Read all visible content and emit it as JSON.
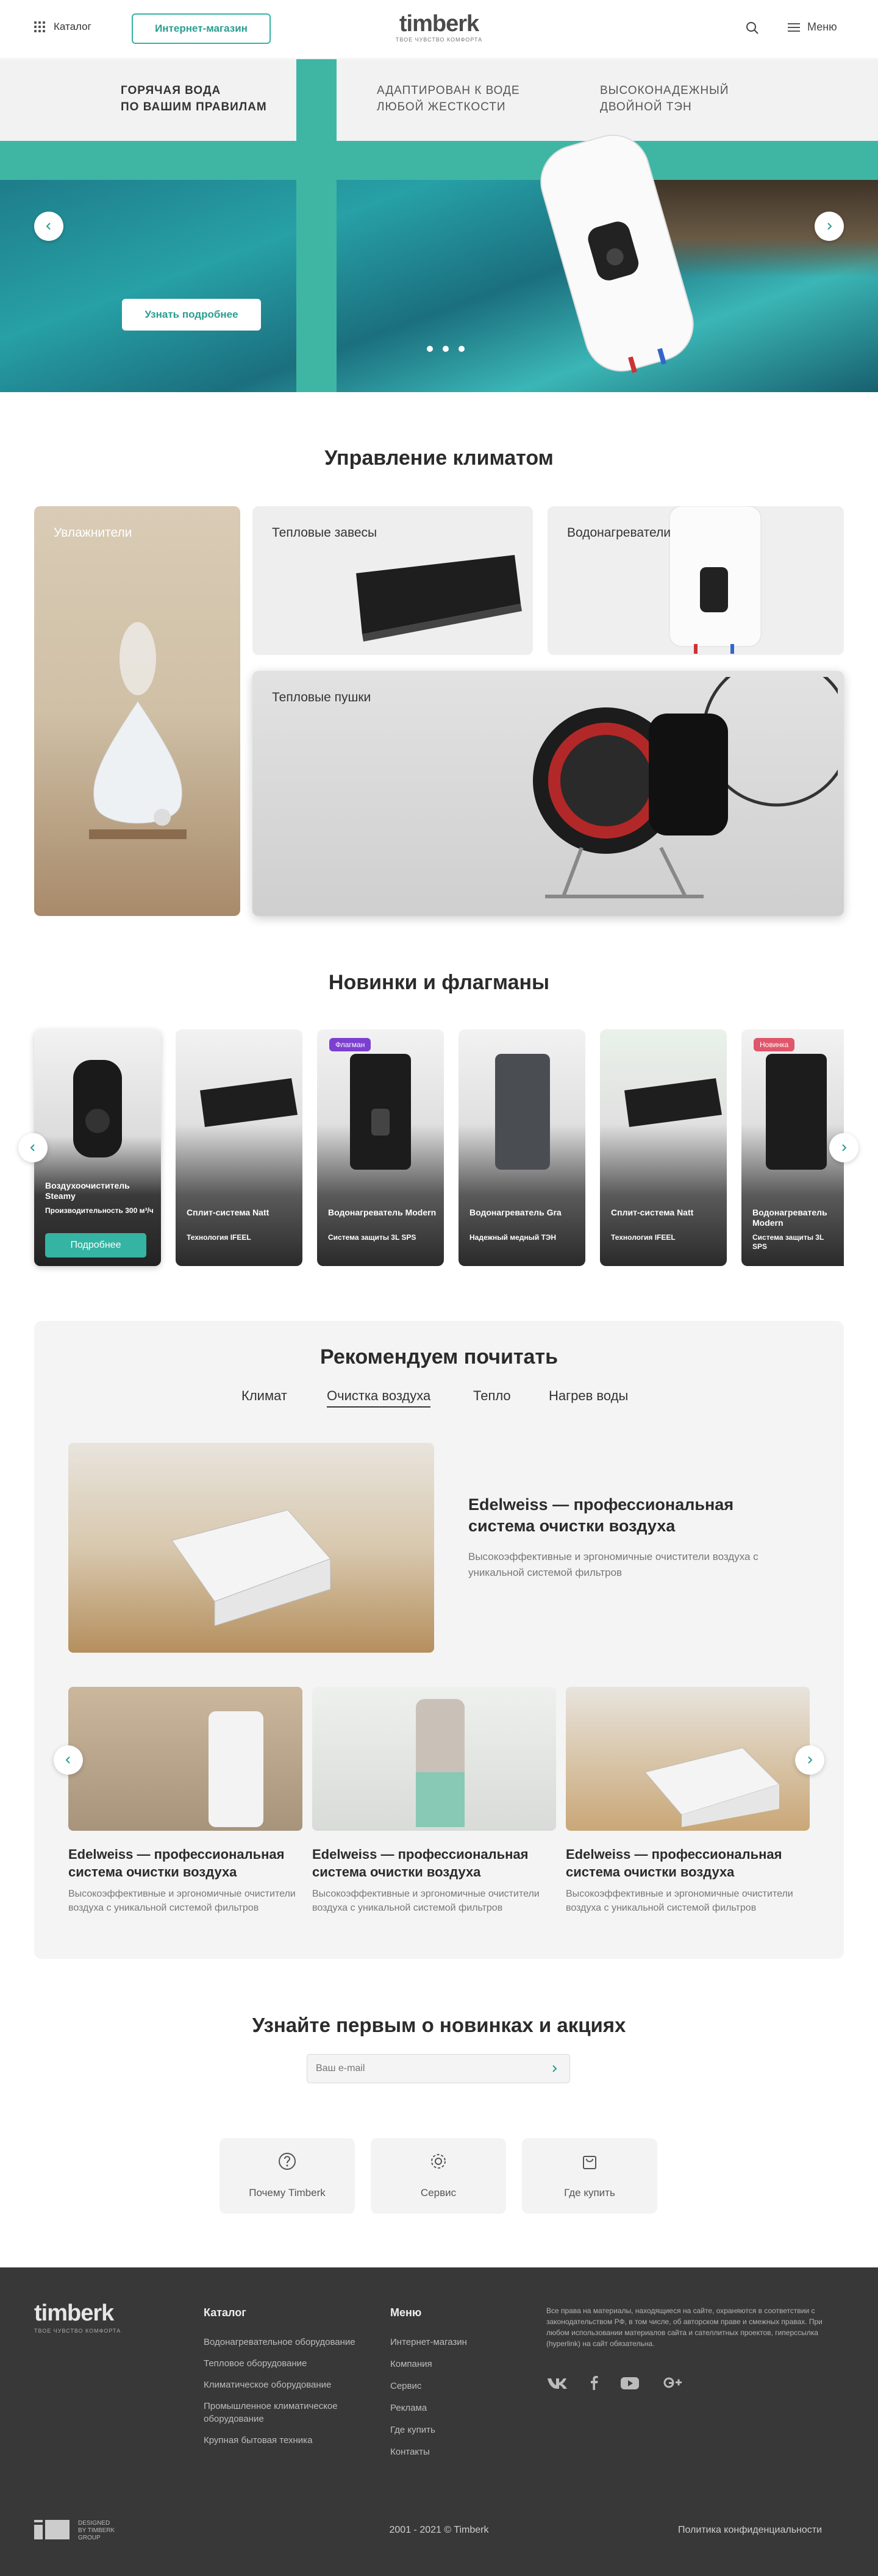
{
  "header": {
    "catalog_label": "Каталог",
    "shop_label": "Интернет-магазин",
    "logo": "timberk",
    "logo_tagline": "ТВОЕ ЧУВСТВО КОМФОРТА",
    "menu_label": "Меню"
  },
  "hero": {
    "text1": "ГОРЯЧАЯ ВОДА\nПО ВАШИМ ПРАВИЛАМ",
    "text2": "АДАПТИРОВАН К ВОДЕ\nЛЮБОЙ ЖЕСТКОСТИ",
    "text3": "ВЫСОКОНАДЕЖНЫЙ\nДВОЙНОЙ ТЭН",
    "cta": "Узнать подробнее",
    "accent_color": "#3fb6a4"
  },
  "climate": {
    "title": "Управление климатом",
    "cards": [
      {
        "label": "Увлажнители"
      },
      {
        "label": "Тепловые завесы"
      },
      {
        "label": "Водонагреватели"
      },
      {
        "label": "Тепловые пушки"
      }
    ]
  },
  "products": {
    "title": "Новинки и флагманы",
    "items": [
      {
        "name": "Воздухоочиститель Steamy",
        "spec": "Производительность 300 м³/ч",
        "cta": "Подробнее",
        "badge": ""
      },
      {
        "name": "Сплит-система Natt",
        "spec": "Технология IFEEL",
        "badge": ""
      },
      {
        "name": "Водонагреватель Modern",
        "spec": "Система защиты 3L SPS",
        "badge": "Флагман"
      },
      {
        "name": "Водонагреватель Gra",
        "spec": "Надежный медный ТЭН",
        "badge": ""
      },
      {
        "name": "Сплит-система Natt",
        "spec": "Технология IFEEL",
        "badge": ""
      },
      {
        "name": "Водонагреватель Modern",
        "spec": "Система защиты 3L SPS",
        "badge": "Новинка"
      }
    ]
  },
  "reading": {
    "title": "Рекомендуем почитать",
    "tabs": [
      "Климат",
      "Очистка воздуха",
      "Тепло",
      "Нагрев воды"
    ],
    "featured": {
      "title": "Edelweiss — профессиональная система очистки воздуха",
      "desc": "Высокоэффективные и эргономичные очистители воздуха с уникальной системой фильтров"
    },
    "articles": [
      {
        "title": "Edelweiss — профессиональная система очистки воздуха",
        "desc": "Высокоэффективные и эргономичные очистители воздуха с уникальной системой фильтров"
      },
      {
        "title": "Edelweiss — профессиональная система очистки воздуха",
        "desc": "Высокоэффективные и эргономичные очистители воздуха с уникальной системой фильтров"
      },
      {
        "title": "Edelweiss — профессиональная система очистки воздуха",
        "desc": "Высокоэффективные и эргономичные очистители воздуха с уникальной системой фильтров"
      }
    ]
  },
  "subscribe": {
    "title": "Узнайте первым о новинках и акциях",
    "placeholder": "Ваш e-mail"
  },
  "services": [
    {
      "label": "Почему Timberk",
      "icon": "question-icon"
    },
    {
      "label": "Сервис",
      "icon": "gear-icon"
    },
    {
      "label": "Где купить",
      "icon": "bag-icon"
    }
  ],
  "footer": {
    "logo": "timberk",
    "logo_tagline": "ТВОЕ ЧУВСТВО КОМФОРТА",
    "catalog_title": "Каталог",
    "catalog_items": [
      "Водонагревательное оборудование",
      "Тепловое оборудование",
      "Климатическое оборудование",
      "Промышленное климатическое оборудование",
      "Крупная бытовая техника"
    ],
    "menu_title": "Меню",
    "menu_items": [
      "Интернет-магазин",
      "Компания",
      "Сервис",
      "Реклама",
      "Где купить",
      "Контакты"
    ],
    "legal": "Все права на материалы, находящиеся на сайте, охраняются в соответствии с законодательством РФ, в том числе, об авторском праве и смежных правах. При любом использовании материалов сайта и сателлитных проектов, гиперссылка (hyperlink) на сайт обязательна.",
    "designed": "DESIGNED\nBY TIMBERK\nGROUP",
    "copyright": "2001 - 2021 © Timberk",
    "privacy": "Политика конфиденциальности"
  }
}
